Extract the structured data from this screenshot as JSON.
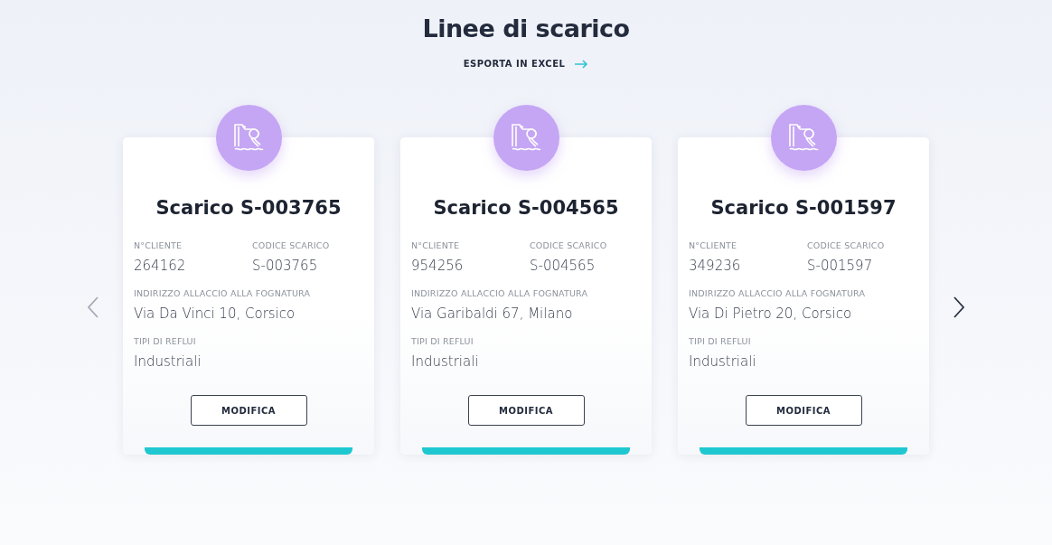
{
  "title": "Linee di scarico",
  "export_link": {
    "label": "ESPORTA IN EXCEL"
  },
  "carousel": {
    "prev": {
      "disabled": true
    },
    "next": {
      "disabled": false
    }
  },
  "cards": [
    {
      "title": "Scarico S-003765",
      "fields": [
        {
          "label": "N°CLIENTE",
          "value": "264162"
        },
        {
          "label": "CODICE SCARICO",
          "value": "S-003765"
        },
        {
          "label": "INDIRIZZO ALLACCIO ALLA FOGNATURA",
          "value": "Via Da Vinci 10, Corsico"
        },
        {
          "label": "TIPI DI REFLUI",
          "value": "Industriali"
        }
      ],
      "button": "MODIFICA"
    },
    {
      "title": "Scarico S-004565",
      "fields": [
        {
          "label": "N°CLIENTE",
          "value": "954256"
        },
        {
          "label": "CODICE SCARICO",
          "value": "S-004565"
        },
        {
          "label": "INDIRIZZO ALLACCIO ALLA FOGNATURA",
          "value": "Via Garibaldi 67, Milano"
        },
        {
          "label": "TIPI DI REFLUI",
          "value": "Industriali"
        }
      ],
      "button": "MODIFICA"
    },
    {
      "title": "Scarico S-001597",
      "fields": [
        {
          "label": "N°CLIENTE",
          "value": "349236"
        },
        {
          "label": "CODICE SCARICO",
          "value": "S-001597"
        },
        {
          "label": "INDIRIZZO ALLACCIO ALLA FOGNATURA",
          "value": "Via Di Pietro 20, Corsico"
        },
        {
          "label": "TIPI DI REFLUI",
          "value": "Industriali"
        }
      ],
      "button": "MODIFICA"
    }
  ]
}
